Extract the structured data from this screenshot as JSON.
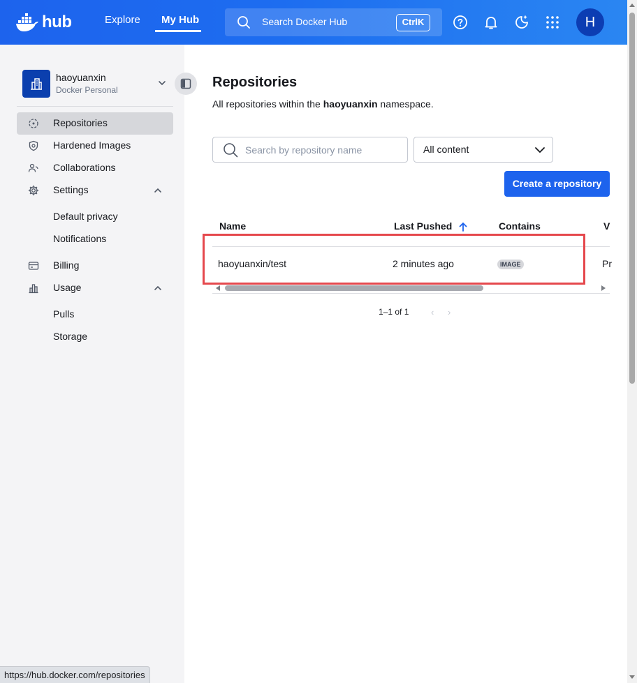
{
  "topbar": {
    "logo_text": "hub",
    "nav": {
      "explore": "Explore",
      "my_hub": "My Hub"
    },
    "search_placeholder": "Search Docker Hub",
    "shortcut": "CtrlK",
    "avatar_initial": "H",
    "icons": [
      "search-icon",
      "help-icon",
      "bell-icon",
      "theme-icon",
      "apps-grid-icon"
    ]
  },
  "sidebar": {
    "org_name": "haoyuanxin",
    "org_type": "Docker Personal",
    "items": {
      "repositories": "Repositories",
      "hardened_images": "Hardened Images",
      "collaborations": "Collaborations",
      "settings": "Settings",
      "default_privacy": "Default privacy",
      "notifications": "Notifications",
      "billing": "Billing",
      "usage": "Usage",
      "pulls": "Pulls",
      "storage": "Storage"
    },
    "active": "repositories"
  },
  "main": {
    "title": "Repositories",
    "desc_prefix": "All repositories within the ",
    "desc_namespace": "haoyuanxin",
    "desc_suffix": " namespace.",
    "search_placeholder": "Search by repository name",
    "filter_value": "All content",
    "create_button": "Create a repository",
    "table": {
      "headers": {
        "name": "Name",
        "last_pushed": "Last Pushed",
        "contains": "Contains",
        "visibility_partial": "V"
      },
      "rows": [
        {
          "name": "haoyuanxin/test",
          "last_pushed": "2 minutes ago",
          "contains": "IMAGE",
          "visibility_partial": "Pr"
        }
      ]
    },
    "pagination": "1–1 of 1"
  },
  "status_bar_url": "https://hub.docker.com/repositories",
  "colors": {
    "brand_blue": "#1d63ed",
    "highlight_red": "#e5484d",
    "sidebar_bg": "#f4f4f6"
  }
}
